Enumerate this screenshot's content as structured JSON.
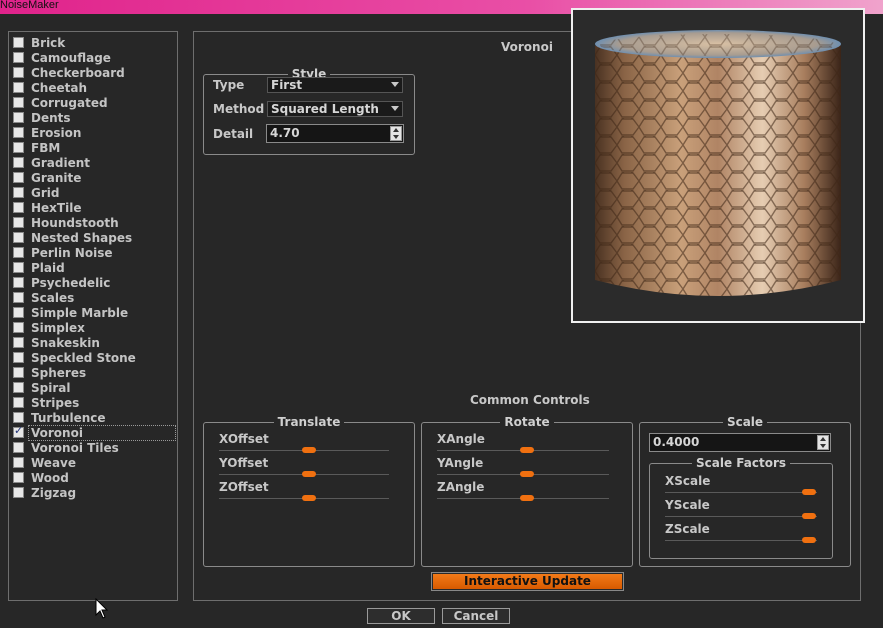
{
  "window": {
    "title": "NoiseMaker"
  },
  "noise_list": {
    "items": [
      {
        "label": "Brick",
        "checked": false
      },
      {
        "label": "Camouflage",
        "checked": false
      },
      {
        "label": "Checkerboard",
        "checked": false
      },
      {
        "label": "Cheetah",
        "checked": false
      },
      {
        "label": "Corrugated",
        "checked": false
      },
      {
        "label": "Dents",
        "checked": false
      },
      {
        "label": "Erosion",
        "checked": false
      },
      {
        "label": "FBM",
        "checked": false
      },
      {
        "label": "Gradient",
        "checked": false
      },
      {
        "label": "Granite",
        "checked": false
      },
      {
        "label": "Grid",
        "checked": false
      },
      {
        "label": "HexTile",
        "checked": false
      },
      {
        "label": "Houndstooth",
        "checked": false
      },
      {
        "label": "Nested Shapes",
        "checked": false
      },
      {
        "label": "Perlin Noise",
        "checked": false
      },
      {
        "label": "Plaid",
        "checked": false
      },
      {
        "label": "Psychedelic",
        "checked": false
      },
      {
        "label": "Scales",
        "checked": false
      },
      {
        "label": "Simple Marble",
        "checked": false
      },
      {
        "label": "Simplex",
        "checked": false
      },
      {
        "label": "Snakeskin",
        "checked": false
      },
      {
        "label": "Speckled Stone",
        "checked": false
      },
      {
        "label": "Spheres",
        "checked": false
      },
      {
        "label": "Spiral",
        "checked": false
      },
      {
        "label": "Stripes",
        "checked": false
      },
      {
        "label": "Turbulence",
        "checked": false
      },
      {
        "label": "Voronoi",
        "checked": true
      },
      {
        "label": "Voronoi Tiles",
        "checked": false
      },
      {
        "label": "Weave",
        "checked": false
      },
      {
        "label": "Wood",
        "checked": false
      },
      {
        "label": "Zigzag",
        "checked": false
      }
    ]
  },
  "main": {
    "title": "Voronoi",
    "style": {
      "legend": "Style",
      "type_label": "Type",
      "type_value": "First",
      "method_label": "Method",
      "method_value": "Squared Length",
      "detail_label": "Detail",
      "detail_value": "4.70"
    },
    "common_controls": "Common Controls",
    "translate": {
      "legend": "Translate",
      "x": {
        "label": "XOffset",
        "value": 0.5
      },
      "y": {
        "label": "YOffset",
        "value": 0.5
      },
      "z": {
        "label": "ZOffset",
        "value": 0.5
      }
    },
    "rotate": {
      "legend": "Rotate",
      "x": {
        "label": "XAngle",
        "value": 0.5
      },
      "y": {
        "label": "YAngle",
        "value": 0.5
      },
      "z": {
        "label": "ZAngle",
        "value": 0.5
      }
    },
    "scale": {
      "legend": "Scale",
      "value": "0.4000",
      "factors_legend": "Scale Factors",
      "x": {
        "label": "XScale",
        "value": 1.0
      },
      "y": {
        "label": "YScale",
        "value": 1.0
      },
      "z": {
        "label": "ZScale",
        "value": 1.0
      }
    },
    "interactive_update": "Interactive Update"
  },
  "buttons": {
    "ok": "OK",
    "cancel": "Cancel"
  },
  "colors": {
    "accent": "#f07010",
    "titlebar": "#e0238b",
    "background": "#272727"
  }
}
